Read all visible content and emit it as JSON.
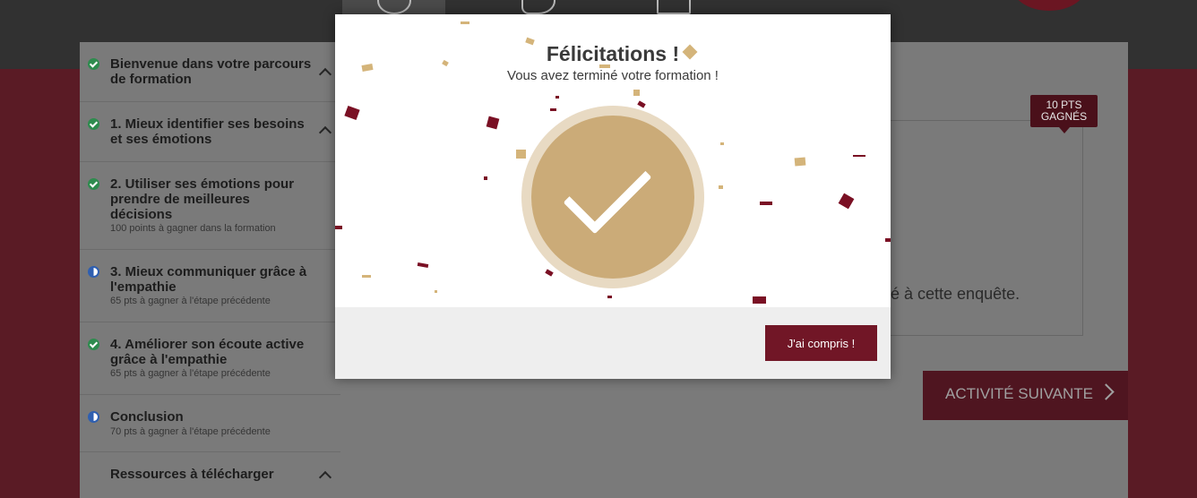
{
  "sidebar": {
    "steps": [
      {
        "title": "Bienvenue dans votre parcours de formation",
        "subtitle": "",
        "status": "completed"
      },
      {
        "title": "1. Mieux identifier ses besoins et ses émotions",
        "subtitle": "",
        "status": "completed"
      },
      {
        "title": "2. Utiliser ses émotions pour prendre de meilleures décisions",
        "subtitle": "100 points à gagner dans la formation",
        "status": "completed"
      },
      {
        "title": "3. Mieux communiquer grâce à l'empathie",
        "subtitle": "65 pts à gagner à l'étape précédente",
        "status": "in-progress"
      },
      {
        "title": "4. Améliorer son écoute active grâce à l'empathie",
        "subtitle": "65 pts à gagner à l'étape précédente",
        "status": "completed"
      },
      {
        "title": "Conclusion",
        "subtitle": "70 pts à gagner à l'étape précédente",
        "status": "in-progress"
      },
      {
        "title": "Ressources à télécharger",
        "subtitle": "",
        "status": "none"
      }
    ]
  },
  "main": {
    "points_badge": "10 PTS GAGNÉS",
    "body_text": "é à cette enquête.",
    "next_button": "ACTIVITÉ SUIVANTE"
  },
  "modal": {
    "title": "Félicitations !",
    "subtitle": "Vous avez terminé votre formation !",
    "confirm_button": "J'ai compris !"
  },
  "colors": {
    "accent": "#711626",
    "check_gold": "#cbab78",
    "check_ring": "#e8dac3",
    "confetti_red": "#7a1024",
    "confetti_gold": "#d4b47a"
  },
  "icons": [
    "clock-icon",
    "speech-bubble-icon",
    "chart-icon",
    "check-circle-icon",
    "progress-circle-icon",
    "chevron-up-icon",
    "chevron-right-icon",
    "checkmark-icon"
  ]
}
